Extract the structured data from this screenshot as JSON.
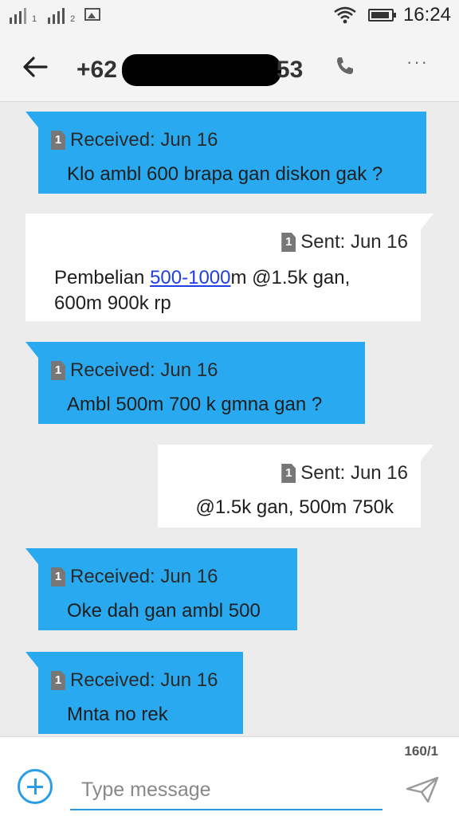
{
  "status_bar": {
    "sim1": "1",
    "sim2": "2",
    "time": "16:24",
    "icons": [
      "signal-icon",
      "signal-icon",
      "image-notification-icon",
      "wifi-icon",
      "battery-icon"
    ]
  },
  "header": {
    "contact_prefix": "+62",
    "contact_suffix": "53",
    "icons": [
      "back-arrow-icon",
      "phone-icon",
      "more-icon"
    ]
  },
  "messages": [
    {
      "type": "received",
      "sim": "1",
      "meta": "Received: Jun 16",
      "text": "Klo ambl 600 brapa gan diskon gak ?"
    },
    {
      "type": "sent",
      "sim": "1",
      "meta": "Sent: Jun 16",
      "text_before_link": "Pembelian ",
      "link": "500-1000",
      "text_after_link": "m @1.5k gan,",
      "text_line2": "600m 900k rp"
    },
    {
      "type": "received",
      "sim": "1",
      "meta": "Received: Jun 16",
      "text": "Ambl 500m 700 k gmna gan ?"
    },
    {
      "type": "sent",
      "sim": "1",
      "meta": "Sent: Jun 16",
      "text": "@1.5k gan, 500m 750k"
    },
    {
      "type": "received",
      "sim": "1",
      "meta": "Received: Jun 16",
      "text": "Oke dah gan ambl 500"
    },
    {
      "type": "received",
      "sim": "1",
      "meta": "Received: Jun 16",
      "text": "Mnta no rek"
    }
  ],
  "composer": {
    "counter": "160/1",
    "placeholder": "Type message",
    "icons": [
      "add-icon",
      "send-icon"
    ]
  },
  "colors": {
    "received_bubble": "#29aaf0",
    "sent_bubble": "#ffffff",
    "background": "#ececec",
    "accent": "#2a9de8"
  }
}
